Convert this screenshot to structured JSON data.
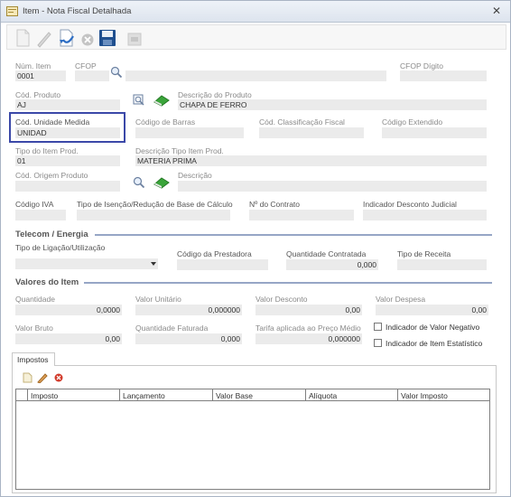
{
  "window": {
    "title": "Item - Nota Fiscal Detalhada",
    "close": "✕"
  },
  "toolbar": {
    "buttons": [
      "new-icon",
      "edit-icon",
      "save-confirm-icon",
      "cancel-icon",
      "save-disk-icon",
      "lock-icon"
    ]
  },
  "fields": {
    "num_item": {
      "label": "Núm. Item",
      "value": "0001"
    },
    "cfop": {
      "label": "CFOP",
      "value": ""
    },
    "cfop_digito": {
      "label": "CFOP Dígito",
      "value": ""
    },
    "cod_produto": {
      "label": "Cód. Produto",
      "value": "AJ"
    },
    "descricao_produto": {
      "label": "Descrição do Produto",
      "value": "CHAPA DE FERRO"
    },
    "cod_unidade_medida": {
      "label": "Cód. Unidade Medida",
      "value": "UNIDAD"
    },
    "codigo_barras": {
      "label": "Código de Barras",
      "value": ""
    },
    "cod_class_fiscal": {
      "label": "Cód. Classificação Fiscal",
      "value": ""
    },
    "codigo_extendido": {
      "label": "Código Extendido",
      "value": ""
    },
    "tipo_item_prod": {
      "label": "Tipo do Item Prod.",
      "value": "01"
    },
    "desc_tipo_item_prod": {
      "label": "Descrição Tipo Item Prod.",
      "value": "MATERIA PRIMA"
    },
    "cod_origem_produto": {
      "label": "Cód. Origem Produto",
      "value": ""
    },
    "descricao": {
      "label": "Descrição",
      "value": ""
    },
    "codigo_iva": {
      "label": "Código IVA",
      "value": ""
    },
    "tipo_isencao": {
      "label": "Tipo de Isenção/Redução de Base de Cálculo",
      "value": ""
    },
    "num_contrato": {
      "label": "Nº do Contrato",
      "value": ""
    },
    "indicador_desconto_judicial": {
      "label": "Indicador Desconto Judicial",
      "value": ""
    }
  },
  "telecom": {
    "title": "Telecom / Energia",
    "tipo_ligacao": {
      "label": "Tipo de Ligação/Utilização",
      "value": ""
    },
    "codigo_prestadora": {
      "label": "Código da Prestadora",
      "value": ""
    },
    "quantidade_contratada": {
      "label": "Quantidade Contratada",
      "value": "0,000"
    },
    "tipo_receita": {
      "label": "Tipo de Receita",
      "value": ""
    }
  },
  "valores": {
    "title": "Valores do Item",
    "quantidade": {
      "label": "Quantidade",
      "value": "0,0000"
    },
    "valor_unitario": {
      "label": "Valor Unitário",
      "value": "0,000000"
    },
    "valor_desconto": {
      "label": "Valor Desconto",
      "value": "0,00"
    },
    "valor_despesa": {
      "label": "Valor Despesa",
      "value": "0,00"
    },
    "valor_bruto": {
      "label": "Valor Bruto",
      "value": "0,00"
    },
    "quantidade_faturada": {
      "label": "Quantidade Faturada",
      "value": "0,000"
    },
    "tarifa": {
      "label": "Tarifa aplicada ao Preço Médio",
      "value": "0,000000"
    },
    "indicador_valor_negativo": {
      "label": "Indicador de Valor Negativo",
      "checked": false
    },
    "indicador_item_estatistico": {
      "label": "Indicador de Item Estatístico",
      "checked": false
    }
  },
  "tabs": {
    "impostos": "Impostos"
  },
  "impostos_grid": {
    "columns": [
      "Imposto",
      "Lançamento",
      "Valor Base",
      "Alíquota",
      "Valor Imposto"
    ]
  }
}
